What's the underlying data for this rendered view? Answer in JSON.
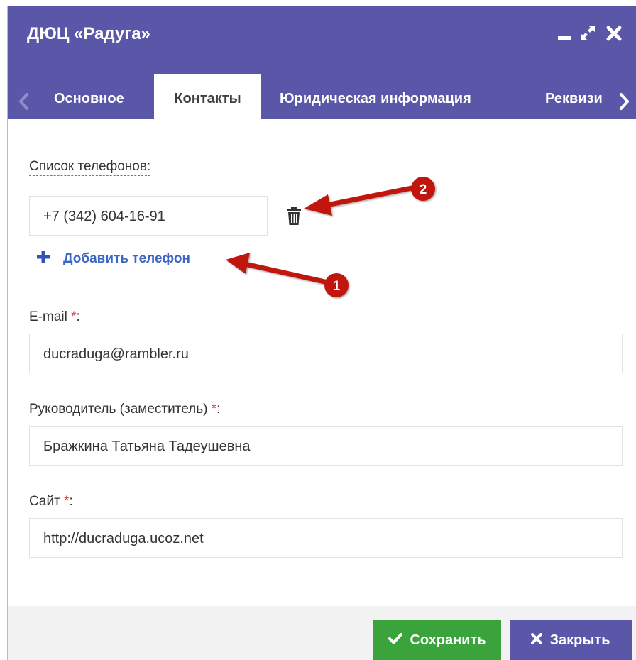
{
  "window": {
    "title": "ДЮЦ «Радуга»",
    "controls": [
      "minimize-icon",
      "maximize-icon",
      "close-icon"
    ]
  },
  "tabs": [
    {
      "label": "Основное",
      "active": false
    },
    {
      "label": "Контакты",
      "active": true
    },
    {
      "label": "Юридическая информация",
      "active": false
    },
    {
      "label": "Реквизи",
      "active": false
    }
  ],
  "form": {
    "phones_label": "Список телефонов:",
    "phone_value": "+7 (342) 604-16-91",
    "add_phone_label": "Добавить телефон",
    "email_label": "E-mail ",
    "email_value": "ducraduga@rambler.ru",
    "head_label": "Руководитель (заместитель) ",
    "head_value": "Бражкина Татьяна Тадеушевна",
    "site_label": "Сайт ",
    "site_value": "http://ducraduga.ucoz.net",
    "required_mark": "*",
    "colon": ":"
  },
  "footer": {
    "save_label": "Сохранить",
    "close_label": "Закрыть"
  },
  "annotations": {
    "badge_1": "1",
    "badge_2": "2"
  },
  "colors": {
    "header": "#5a57a8",
    "save": "#3ba33c",
    "link": "#3c66c4",
    "required": "#e03a3a",
    "annotation": "#c0160f"
  }
}
